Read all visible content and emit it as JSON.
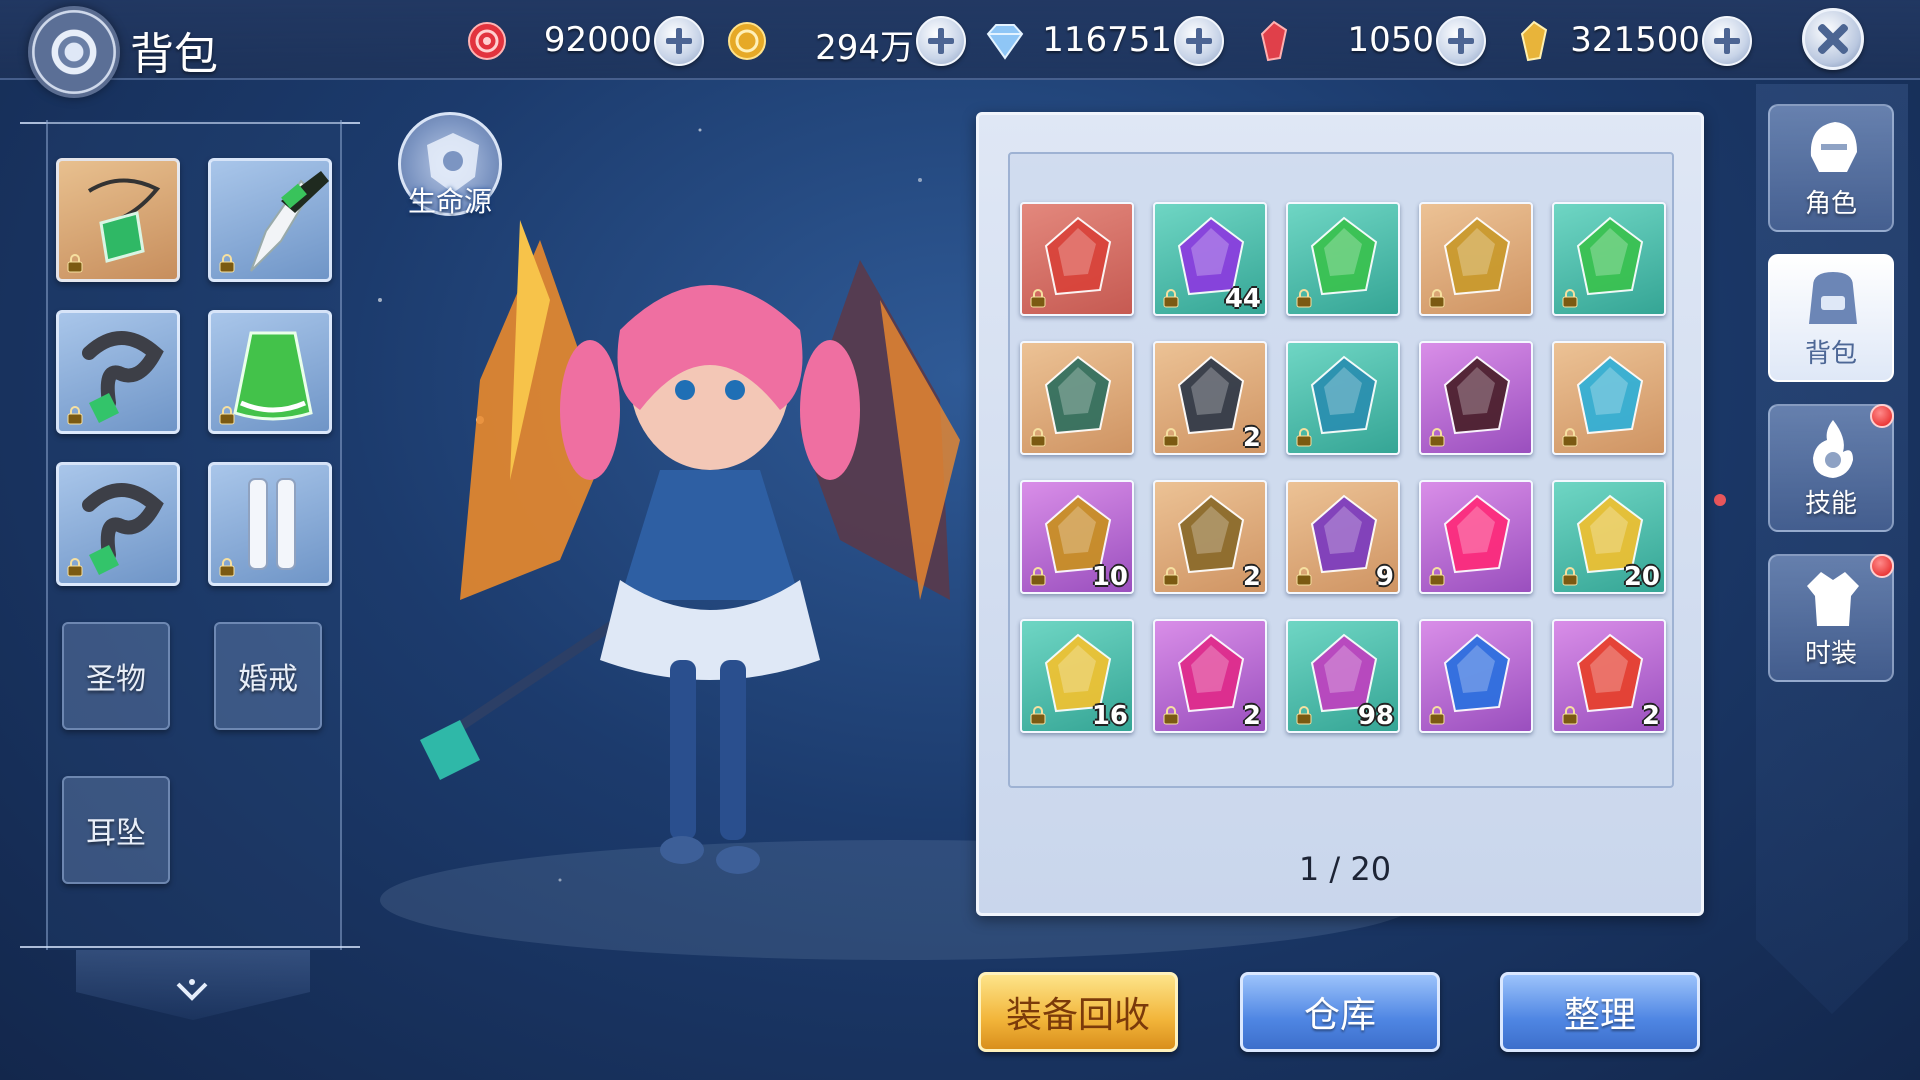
{
  "header": {
    "title": "背包",
    "currencies": [
      {
        "icon": "red-coin-icon",
        "value": "92000"
      },
      {
        "icon": "gold-coin-icon",
        "value": "294万"
      },
      {
        "icon": "diamond-icon",
        "value": "116751"
      },
      {
        "icon": "red-crystal-icon",
        "value": "1050"
      },
      {
        "icon": "gold-crystal-icon",
        "value": "321500"
      }
    ]
  },
  "equipment": {
    "empty_slots": {
      "holy": "圣物",
      "ring": "婚戒",
      "earring": "耳坠"
    }
  },
  "character": {
    "life_source": "生命源"
  },
  "inventory": {
    "items": [
      {
        "name": "red-ore",
        "qty": "",
        "bg": "red"
      },
      {
        "name": "purple-crystal",
        "qty": "44",
        "bg": "teal"
      },
      {
        "name": "green-dress",
        "qty": "",
        "bg": "teal"
      },
      {
        "name": "title-badge",
        "qty": "",
        "bg": "tan"
      },
      {
        "name": "green-dress",
        "qty": "",
        "bg": "teal"
      },
      {
        "name": "emblem-wings",
        "qty": "",
        "bg": "tan"
      },
      {
        "name": "dark-stone",
        "qty": "2",
        "bg": "tan"
      },
      {
        "name": "blue-staff",
        "qty": "",
        "bg": "teal"
      },
      {
        "name": "demon-mask",
        "qty": "",
        "bg": "purple"
      },
      {
        "name": "blue-rune",
        "qty": "",
        "bg": "tan"
      },
      {
        "name": "heart-token",
        "qty": "10",
        "bg": "purple"
      },
      {
        "name": "money-bundle",
        "qty": "2",
        "bg": "tan"
      },
      {
        "name": "purple-scroll",
        "qty": "9",
        "bg": "tan"
      },
      {
        "name": "pink-gem",
        "qty": "",
        "bg": "purple"
      },
      {
        "name": "gold-crystal",
        "qty": "20",
        "bg": "teal"
      },
      {
        "name": "gold-gem",
        "qty": "16",
        "bg": "teal"
      },
      {
        "name": "pink-crystal",
        "qty": "2",
        "bg": "purple"
      },
      {
        "name": "purple-shard",
        "qty": "98",
        "bg": "teal"
      },
      {
        "name": "blue-roses",
        "qty": "",
        "bg": "purple"
      },
      {
        "name": "red-crystal",
        "qty": "2",
        "bg": "purple"
      }
    ],
    "pager": "1 / 20"
  },
  "buttons": {
    "recycle": "装备回收",
    "warehouse": "仓库",
    "sort": "整理"
  },
  "side_nav": [
    {
      "label": "角色",
      "icon": "helmet-icon",
      "active": false,
      "badge": false
    },
    {
      "label": "背包",
      "icon": "backpack-icon",
      "active": true,
      "badge": false
    },
    {
      "label": "技能",
      "icon": "flame-skill-icon",
      "active": false,
      "badge": true
    },
    {
      "label": "时装",
      "icon": "outfit-icon",
      "active": false,
      "badge": true
    }
  ]
}
